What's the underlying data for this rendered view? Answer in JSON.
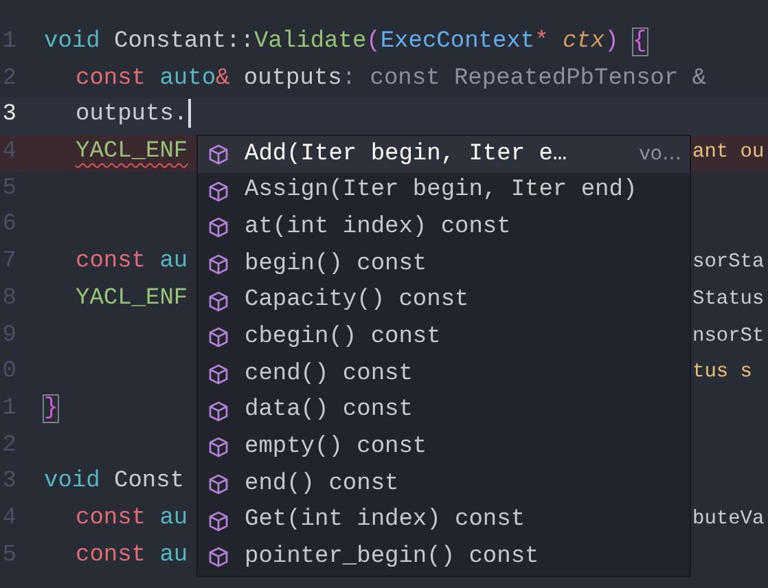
{
  "editor": {
    "lines": [
      {
        "number": "1",
        "current": false,
        "error": false,
        "indented": false,
        "tokens": [
          {
            "kind": "keyword",
            "text": "void"
          },
          {
            "kind": "plain",
            "text": " Constant::"
          },
          {
            "kind": "function",
            "text": "Validate"
          },
          {
            "kind": "paren",
            "text": "("
          },
          {
            "kind": "type",
            "text": "ExecContext"
          },
          {
            "kind": "operator",
            "text": "*"
          },
          {
            "kind": "param",
            "text": " ctx"
          },
          {
            "kind": "paren",
            "text": ") "
          },
          {
            "kind": "brace",
            "text": "{"
          }
        ]
      },
      {
        "number": "2",
        "current": false,
        "error": false,
        "indented": true,
        "tokens": [
          {
            "kind": "storage",
            "text": "const"
          },
          {
            "kind": "keyword",
            "text": " auto"
          },
          {
            "kind": "operator",
            "text": "&"
          },
          {
            "kind": "plain",
            "text": " outputs"
          },
          {
            "kind": "hint",
            "text": ": const RepeatedPbTensor &"
          }
        ]
      },
      {
        "number": "3",
        "current": true,
        "error": false,
        "indented": true,
        "tokens": [
          {
            "kind": "plain",
            "text": "outputs."
          }
        ]
      },
      {
        "number": "4",
        "current": false,
        "error": true,
        "indented": true,
        "tokens": [
          {
            "kind": "macro",
            "text": "YACL_ENF"
          }
        ],
        "right": {
          "kind": "constant",
          "text": "ant ou"
        }
      },
      {
        "number": "5",
        "current": false,
        "error": false
      },
      {
        "number": "6",
        "current": false,
        "error": false
      },
      {
        "number": "7",
        "current": false,
        "error": false,
        "indented": true,
        "tokens": [
          {
            "kind": "storage",
            "text": "const"
          },
          {
            "kind": "keyword",
            "text": " au"
          }
        ],
        "right": {
          "kind": "plain",
          "text": "sorSta"
        }
      },
      {
        "number": "8",
        "current": false,
        "error": false,
        "indented": true,
        "tokens": [
          {
            "kind": "macro",
            "text": "YACL_ENF"
          }
        ],
        "right": {
          "kind": "plain",
          "text": "Status"
        }
      },
      {
        "number": "9",
        "current": false,
        "error": false,
        "right": {
          "kind": "plain",
          "text": "nsorSt"
        }
      },
      {
        "number": "0",
        "current": false,
        "error": false,
        "right": {
          "kind": "constant",
          "text": "tus s"
        }
      },
      {
        "number": "1",
        "current": false,
        "error": false,
        "indented": false,
        "tokens": [
          {
            "kind": "brace",
            "text": "}"
          }
        ]
      },
      {
        "number": "2",
        "current": false,
        "error": false
      },
      {
        "number": "3",
        "current": false,
        "error": false,
        "indented": false,
        "tokens": [
          {
            "kind": "keyword",
            "text": "void"
          },
          {
            "kind": "plain",
            "text": " Const"
          }
        ]
      },
      {
        "number": "4",
        "current": false,
        "error": false,
        "indented": true,
        "tokens": [
          {
            "kind": "storage",
            "text": "const"
          },
          {
            "kind": "keyword",
            "text": " au"
          }
        ],
        "right": {
          "kind": "plain",
          "text": "buteVa"
        }
      },
      {
        "number": "5",
        "current": false,
        "error": false,
        "indented": true,
        "tokens": [
          {
            "kind": "storage",
            "text": "const"
          },
          {
            "kind": "keyword",
            "text": " au"
          }
        ]
      }
    ]
  },
  "suggestions": [
    {
      "label": "Add(Iter begin, Iter e…",
      "detail": "vo…",
      "selected": true
    },
    {
      "label": "Assign(Iter begin, Iter end)",
      "selected": false
    },
    {
      "label": "at(int index) const",
      "selected": false
    },
    {
      "label": "begin() const",
      "selected": false
    },
    {
      "label": "Capacity() const",
      "selected": false
    },
    {
      "label": "cbegin() const",
      "selected": false
    },
    {
      "label": "cend() const",
      "selected": false
    },
    {
      "label": "data() const",
      "selected": false
    },
    {
      "label": "empty() const",
      "selected": false
    },
    {
      "label": "end() const",
      "selected": false
    },
    {
      "label": "Get(int index) const",
      "selected": false
    },
    {
      "label": "pointer_begin() const",
      "selected": false
    }
  ]
}
